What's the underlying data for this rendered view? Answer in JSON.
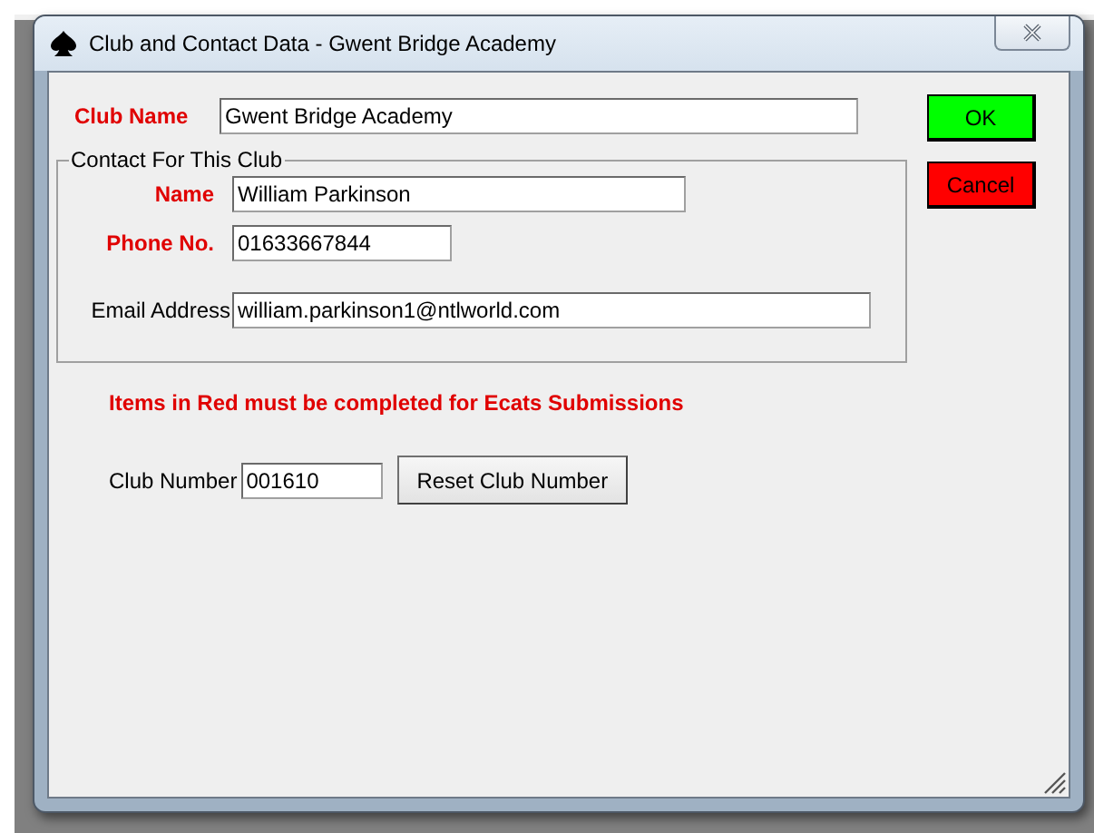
{
  "window": {
    "title": "Club and Contact Data - Gwent Bridge Academy"
  },
  "club_name": {
    "label": "Club Name",
    "value": "Gwent Bridge Academy",
    "required": true
  },
  "contact_group": {
    "title": "Contact For This Club",
    "fields": [
      {
        "label": "Name",
        "value": "William Parkinson",
        "required": true
      },
      {
        "label": "Phone No.",
        "value": "01633667844",
        "required": true
      },
      {
        "label": "Email Address",
        "value": "william.parkinson1@ntlworld.com",
        "required": false
      }
    ]
  },
  "buttons": [
    {
      "label": "OK",
      "color": "#00ff00"
    },
    {
      "label": "Cancel",
      "color": "#ff0000"
    }
  ],
  "notice": "Items in Red must be completed for Ecats Submissions",
  "club_number": {
    "label": "Club Number",
    "value": "001610"
  },
  "reset_button": "Reset Club Number"
}
